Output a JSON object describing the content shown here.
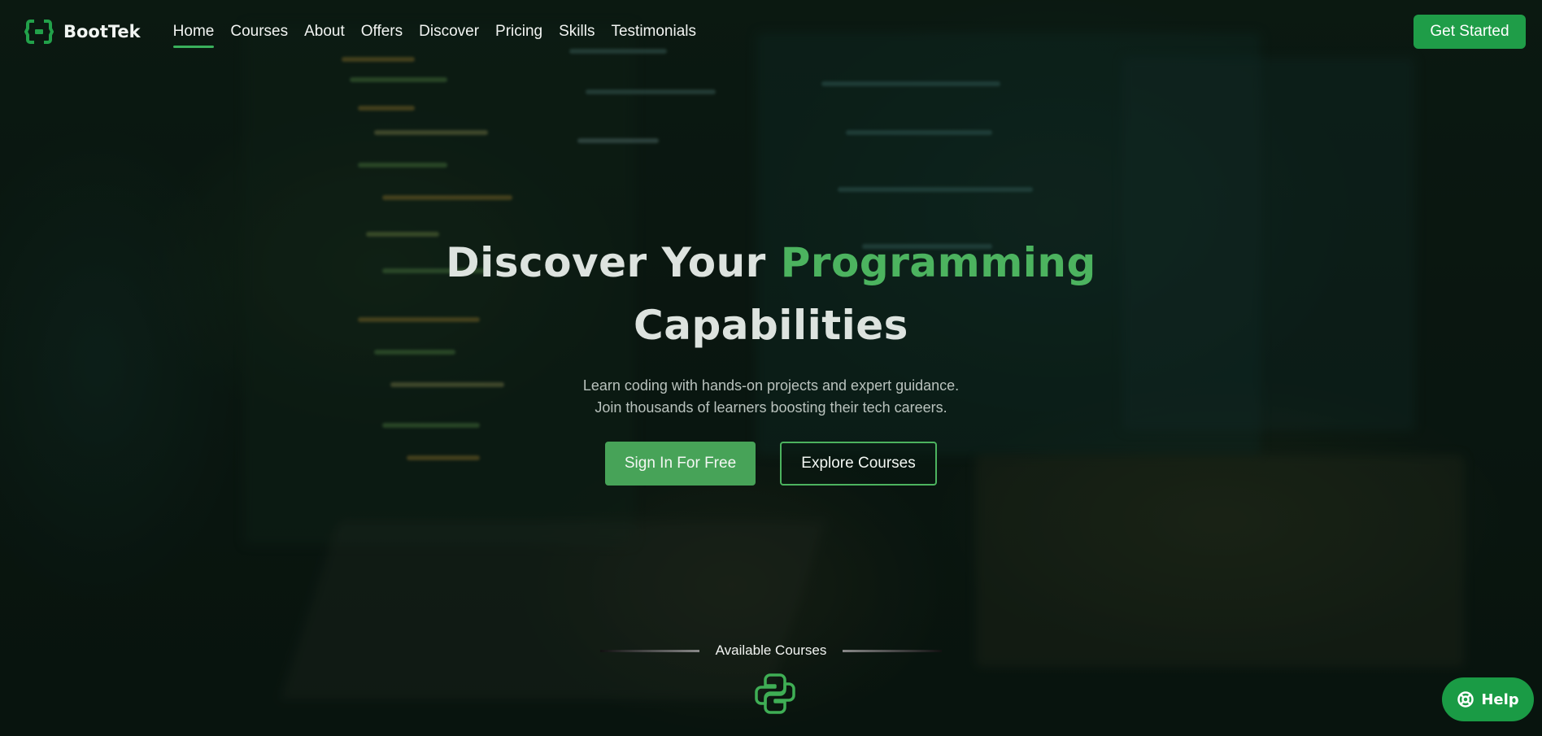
{
  "brand": {
    "name": "BootTek",
    "icon": "code-brackets-icon",
    "accent": "#1f9d48"
  },
  "nav": {
    "items": [
      {
        "label": "Home",
        "active": true
      },
      {
        "label": "Courses",
        "active": false
      },
      {
        "label": "About",
        "active": false
      },
      {
        "label": "Offers",
        "active": false
      },
      {
        "label": "Discover",
        "active": false
      },
      {
        "label": "Pricing",
        "active": false
      },
      {
        "label": "Skills",
        "active": false
      },
      {
        "label": "Testimonials",
        "active": false
      }
    ],
    "cta_label": "Get Started"
  },
  "hero": {
    "title_part1": "Discover Your ",
    "title_accent": "Programming",
    "title_part2": "Capabilities",
    "subtitle_line1": "Learn coding with hands-on projects and expert guidance.",
    "subtitle_line2": "Join thousands of learners boosting their tech careers.",
    "primary_label": "Sign In For Free",
    "secondary_label": "Explore Courses"
  },
  "courses": {
    "heading": "Available Courses",
    "icon": "python-icon"
  },
  "help": {
    "label": "Help",
    "icon": "lifebuoy-icon"
  },
  "colors": {
    "accent_green": "#4cb35f",
    "button_green": "#47a358"
  }
}
